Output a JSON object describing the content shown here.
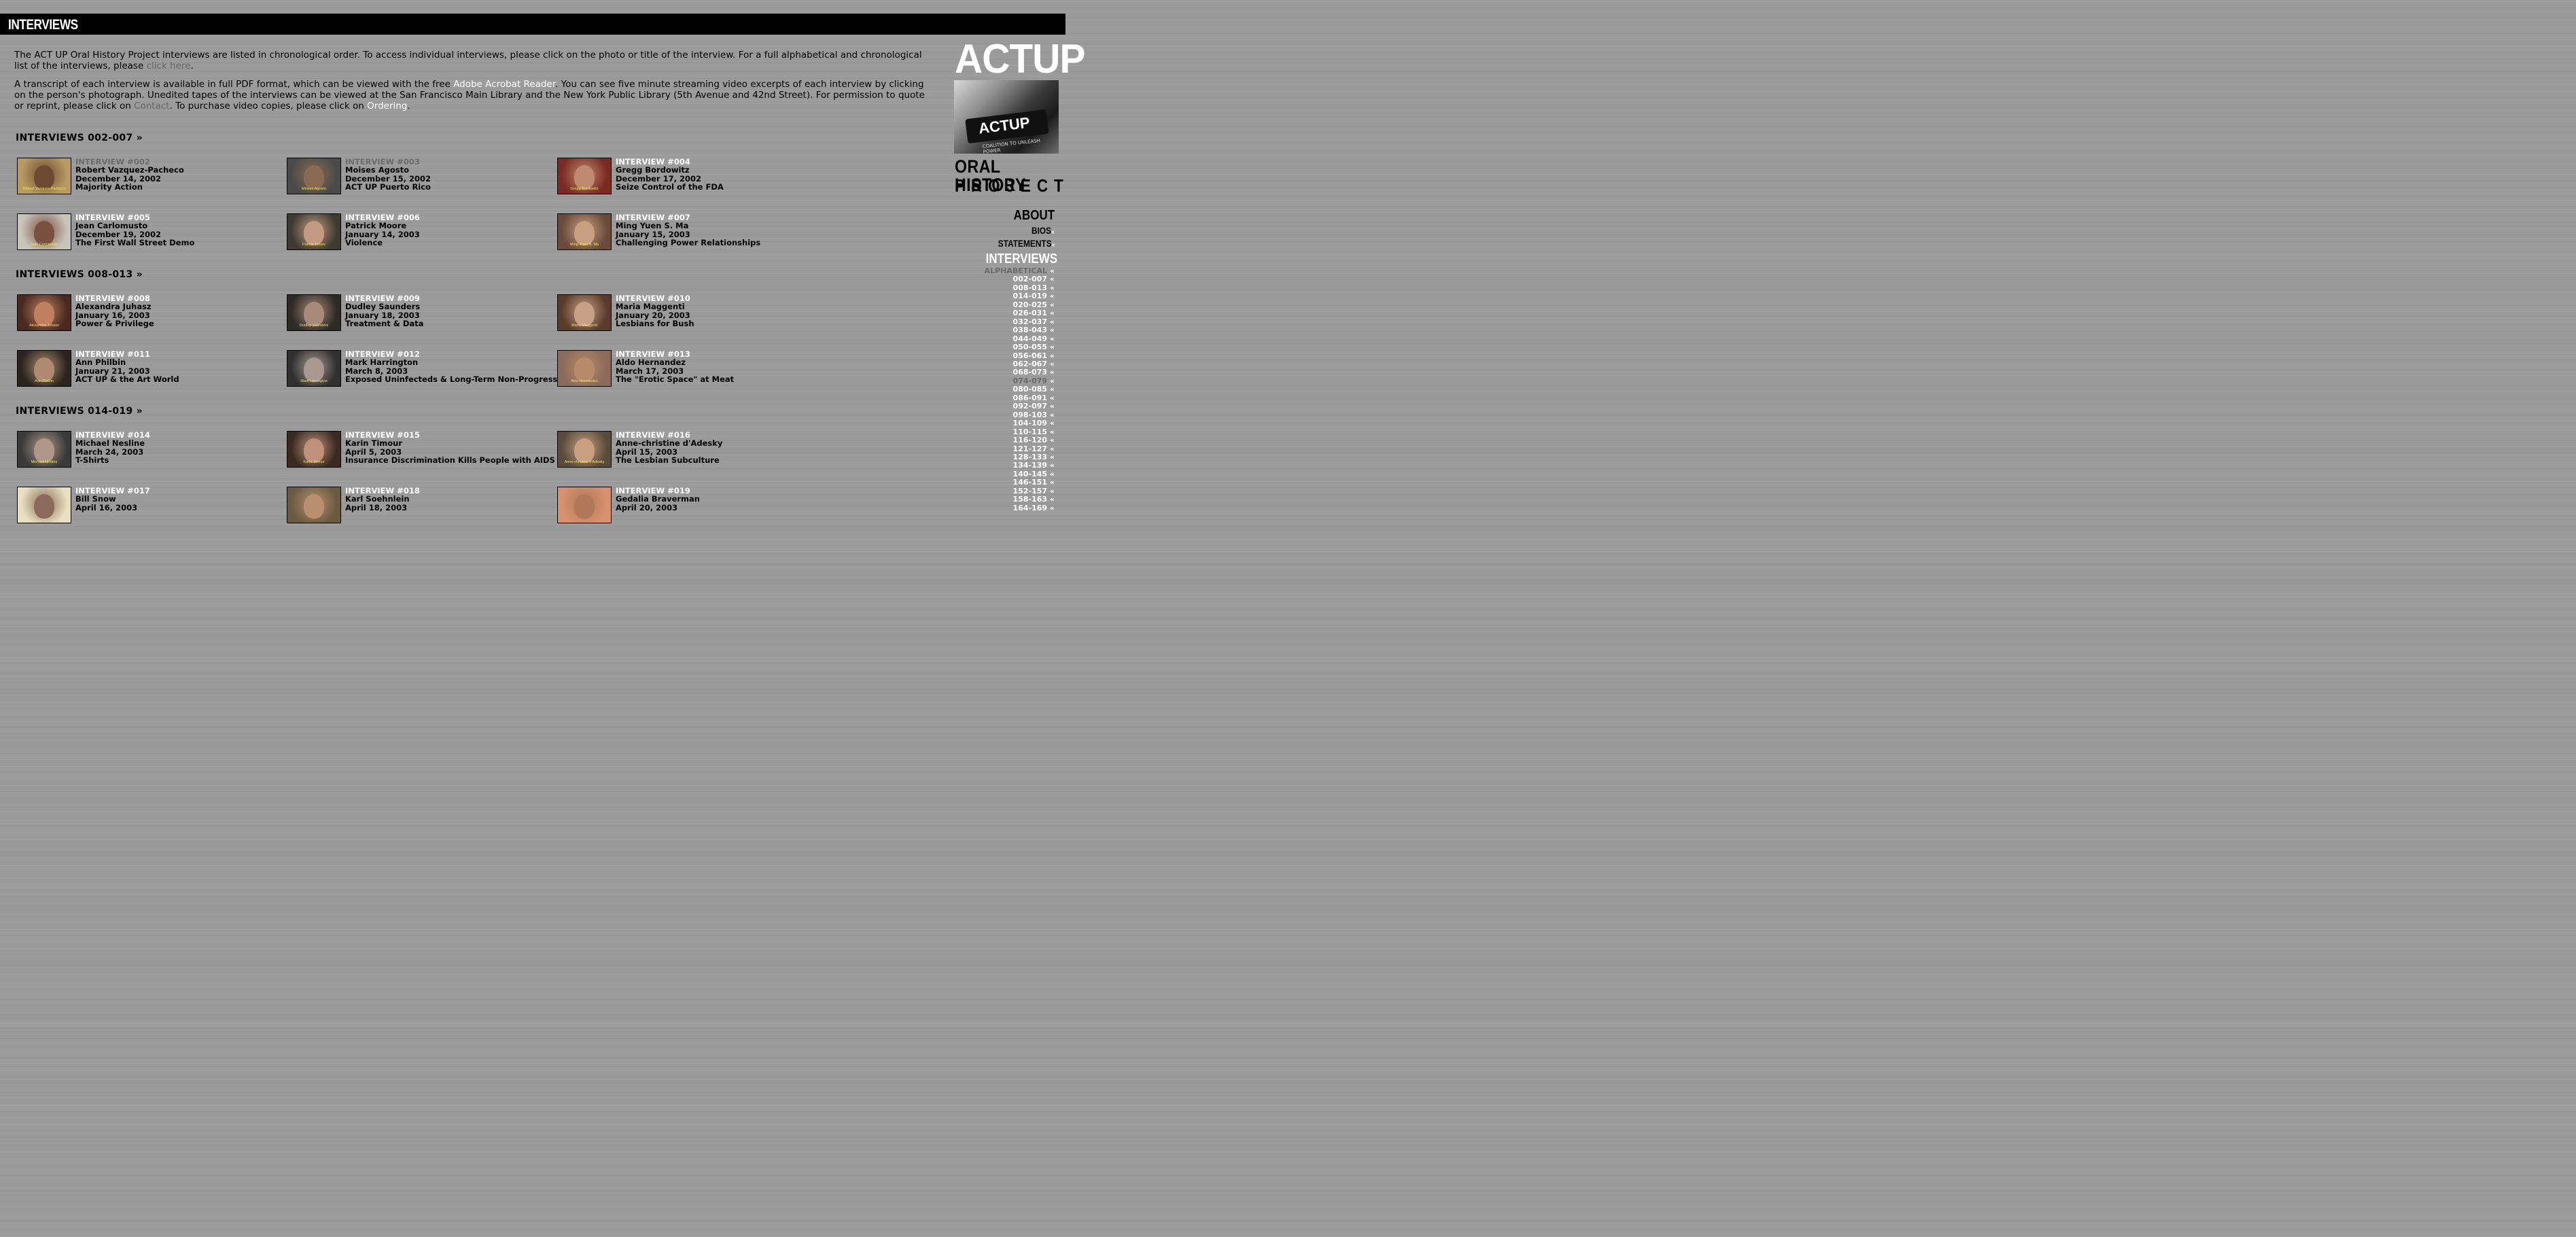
{
  "page_title": "INTERVIEWS",
  "intro": {
    "p1_a": "The ACT UP Oral History Project interviews are listed in chronological order. To access individual interviews, please click on the photo or title of the interview. For a full alphabetical and chronological list of the interviews, please ",
    "p1_link": "click here",
    "p1_b": ".",
    "p2_a": "A transcript of each interview is available in full PDF format, which can be viewed with the free ",
    "p2_link1": "Adobe Acrobat Reader",
    "p2_b": ". You can see five minute streaming video excerpts of each interview by clicking on the person's photograph. Unedited tapes of the interviews can be viewed at the San Francisco Main Library and the New York Public Library (5th Avenue and 42nd Street). For permission to quote or reprint, please click on ",
    "p2_link2": "Contact",
    "p2_c": ". To purchase video copies, please click on ",
    "p2_link3": "Ordering",
    "p2_d": "."
  },
  "groups": [
    {
      "label": "INTERVIEWS 002-007 »"
    },
    {
      "label": "INTERVIEWS 008-013 »"
    },
    {
      "label": "INTERVIEWS 014-019 »"
    }
  ],
  "interviews": [
    {
      "num": "INTERVIEW #002",
      "name": "Robert Vazquez-Pacheco",
      "date": "December 14, 2002",
      "topic": "Majority Action",
      "caption": "Robert Vazquez-Pacheco",
      "dim": true,
      "bg": "#b89a62",
      "face": "#6b4a30"
    },
    {
      "num": "INTERVIEW #003",
      "name": "Moises Agosto",
      "date": "December 15, 2002",
      "topic": "ACT UP Puerto Rico",
      "caption": "Moises Agosto",
      "dim": true,
      "bg": "#4a4a4a",
      "face": "#8a6a50"
    },
    {
      "num": "INTERVIEW #004",
      "name": "Gregg Bordowitz",
      "date": "December 17, 2002",
      "topic": "Seize Control of the FDA",
      "caption": "Gregg Bordowitz",
      "dim": false,
      "bg": "#7a2a22",
      "face": "#c08a70"
    },
    {
      "num": "INTERVIEW #005",
      "name": "Jean Carlomusto",
      "date": "December 19, 2002",
      "topic": "The First Wall Street Demo",
      "caption": "Jean Carlomusto",
      "dim": false,
      "bg": "#c9c4b8",
      "face": "#7a5040"
    },
    {
      "num": "INTERVIEW #006",
      "name": "Patrick Moore",
      "date": "January 14, 2003",
      "topic": "Violence",
      "caption": "Patrick Moore",
      "dim": false,
      "bg": "#3e3a32",
      "face": "#c49a80"
    },
    {
      "num": "INTERVIEW #007",
      "name": "Ming Yuen S. Ma",
      "date": "January 15, 2003",
      "topic": "Challenging Power Relationships",
      "caption": "Ming-Yuen S. Ma",
      "dim": false,
      "bg": "#6a4a3a",
      "face": "#c8a080"
    },
    {
      "num": "INTERVIEW #008",
      "name": "Alexandra Juhasz",
      "date": "January 16, 2003",
      "topic": "Power & Privilege",
      "caption": "Alexandra Juhasz",
      "dim": false,
      "bg": "#4a2a20",
      "face": "#c08060"
    },
    {
      "num": "INTERVIEW #009",
      "name": "Dudley Saunders",
      "date": "January 18, 2003",
      "topic": "Treatment & Data",
      "caption": "Dudley Saunders",
      "dim": false,
      "bg": "#2e2a26",
      "face": "#a88a78"
    },
    {
      "num": "INTERVIEW #010",
      "name": "Maria Maggenti",
      "date": "January 20, 2003",
      "topic": "Lesbians for Bush",
      "caption": "Maria Maggenti",
      "dim": false,
      "bg": "#5a3a2a",
      "face": "#c8a088"
    },
    {
      "num": "INTERVIEW #011",
      "name": "Ann Philbin",
      "date": "January 21, 2003",
      "topic": "ACT UP & the Art World",
      "caption": "Ann Philbin",
      "dim": false,
      "bg": "#2a2420",
      "face": "#b08a70"
    },
    {
      "num": "INTERVIEW #012",
      "name": "Mark Harrington",
      "date": "March 8, 2003",
      "topic": "Exposed Uninfecteds & Long-Term Non-Progressors",
      "caption": "Mark Harrington",
      "dim": false,
      "bg": "#303030",
      "face": "#a89890"
    },
    {
      "num": "INTERVIEW #013",
      "name": "Aldo Hernandez",
      "date": "March 17, 2003",
      "topic": "The \"Erotic Space\" at Meat",
      "caption": "Aldo Hernandez",
      "dim": false,
      "bg": "#8a6a5a",
      "face": "#b88a68"
    },
    {
      "num": "INTERVIEW #014",
      "name": "Michael Nesline",
      "date": "March 24, 2003",
      "topic": "T-Shirts",
      "caption": "Michael Nesline",
      "dim": false,
      "bg": "#3a3a3a",
      "face": "#b09888"
    },
    {
      "num": "INTERVIEW #015",
      "name": "Karin Timour",
      "date": "April 5, 2003",
      "topic": "Insurance Discrimination Kills People with AIDS",
      "caption": "Karin Timour",
      "dim": false,
      "bg": "#3a2a22",
      "face": "#c09078"
    },
    {
      "num": "INTERVIEW #016",
      "name": "Anne-christine d'Adesky",
      "date": "April 15, 2003",
      "topic": "The Lesbian Subculture",
      "caption": "Anne-christine d'Adesky",
      "dim": false,
      "bg": "#5a4a3a",
      "face": "#c8a080"
    },
    {
      "num": "INTERVIEW #017",
      "name": "Bill Snow",
      "date": "April 16, 2003",
      "topic": "",
      "caption": "",
      "dim": false,
      "bg": "#e8e0c0",
      "face": "#8a6a5a"
    },
    {
      "num": "INTERVIEW #018",
      "name": "Karl Soehnlein",
      "date": "April 18, 2003",
      "topic": "",
      "caption": "",
      "dim": false,
      "bg": "#6a5a40",
      "face": "#b89070"
    },
    {
      "num": "INTERVIEW #019",
      "name": "Gedalia Braverman",
      "date": "April 20, 2003",
      "topic": "",
      "caption": "",
      "dim": false,
      "bg": "#d89070",
      "face": "#b07858"
    }
  ],
  "sidebar": {
    "logo_actup": "ACTUP",
    "photo_text": "ACTUP",
    "photo_slogan": "COALITION TO UNLEASH POWER",
    "logo_oral": "ORAL HISTORY",
    "logo_project": "PROJECT",
    "nav_about": "ABOUT",
    "nav_bios": "BIOS",
    "nav_statements": "STATEMENTS",
    "nav_interviews": "INTERVIEWS",
    "arrow": "«",
    "ranges": [
      {
        "label": "ALPHABETICAL",
        "dim": true
      },
      {
        "label": "002-007",
        "dim": false
      },
      {
        "label": "008-013",
        "dim": false
      },
      {
        "label": "014-019",
        "dim": false
      },
      {
        "label": "020-025",
        "dim": false
      },
      {
        "label": "026-031",
        "dim": false
      },
      {
        "label": "032-037",
        "dim": false
      },
      {
        "label": "038-043",
        "dim": false
      },
      {
        "label": "044-049",
        "dim": false
      },
      {
        "label": "050-055",
        "dim": false
      },
      {
        "label": "056-061",
        "dim": false
      },
      {
        "label": "062-067",
        "dim": false
      },
      {
        "label": "068-073",
        "dim": false
      },
      {
        "label": "074-079",
        "dim": true
      },
      {
        "label": "080-085",
        "dim": false
      },
      {
        "label": "086-091",
        "dim": false
      },
      {
        "label": "092-097",
        "dim": false
      },
      {
        "label": "098-103",
        "dim": false
      },
      {
        "label": "104-109",
        "dim": false
      },
      {
        "label": "110-115",
        "dim": false
      },
      {
        "label": "116-120",
        "dim": false
      },
      {
        "label": "121-127",
        "dim": false
      },
      {
        "label": "128-133",
        "dim": false
      },
      {
        "label": "134-139",
        "dim": false
      },
      {
        "label": "140-145",
        "dim": false
      },
      {
        "label": "146-151",
        "dim": false
      },
      {
        "label": "152-157",
        "dim": false
      },
      {
        "label": "158-163",
        "dim": false
      },
      {
        "label": "164-169",
        "dim": false
      }
    ]
  }
}
